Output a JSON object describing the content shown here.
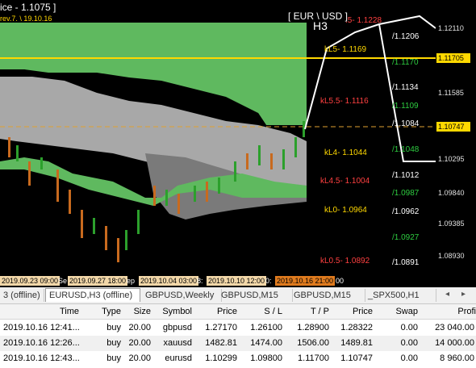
{
  "window": {
    "title": "ice - 1.1075 ]",
    "revision": "rev.7. \\ 19.10.16",
    "pair_label": "[ EUR \\ USD ]",
    "timeframe": "H3"
  },
  "price_axis": {
    "ticks": [
      "1.12110",
      "1.11585",
      "1.10295",
      "1.09840",
      "1.09385",
      "1.08930"
    ],
    "tags": [
      "1.11705",
      "1.10747"
    ]
  },
  "levels_left": [
    {
      "label": "kL5- 1.1169",
      "color": "#ffd800"
    },
    {
      "label": "kL5.5- 1.1116",
      "color": "#ff4040"
    },
    {
      "label": "kL4- 1.1044",
      "color": "#ffd800"
    },
    {
      "label": "kL4.5- 1.1004",
      "color": "#ff4040"
    },
    {
      "label": "kL0- 1.0964",
      "color": "#ffd800"
    },
    {
      "label": "kL0.5- 1.0892",
      "color": "#ff4040"
    },
    {
      "label": ".5- 1.1228",
      "color": "#ff4040"
    }
  ],
  "levels_right": [
    {
      "label": "/1.1206",
      "color": "#ffffff"
    },
    {
      "label": "/1.1170",
      "color": "#2ecc40"
    },
    {
      "label": "/1.1134",
      "color": "#ffffff"
    },
    {
      "label": "/1.1109",
      "color": "#2ecc40"
    },
    {
      "label": "/1.1084",
      "color": "#ffffff"
    },
    {
      "label": "/1.1048",
      "color": "#2ecc40"
    },
    {
      "label": "/1.1012",
      "color": "#ffffff"
    },
    {
      "label": "/1.0987",
      "color": "#2ecc40"
    },
    {
      "label": "/1.0962",
      "color": "#ffffff"
    },
    {
      "label": "/1.0927",
      "color": "#2ecc40"
    },
    {
      "label": "/1.0891",
      "color": "#ffffff"
    }
  ],
  "date_axis": {
    "labels": [
      "2019.09.23 09:00",
      "2019.09.27 18:00",
      "2019.10.04 03:00",
      "2019.10.10 12:00",
      "2019.10.16 21:00"
    ],
    "separators": [
      "Se",
      "ep",
      "8:",
      "0:",
      "00"
    ]
  },
  "tabs": {
    "items": [
      "3 (offline)",
      "EURUSD,H3 (offline)",
      "GBPUSD,Weekly",
      "GBPUSD,M15",
      "GBPUSD,M15",
      "_SPX500,H1"
    ],
    "active_index": 1,
    "nav_prev": "◂",
    "nav_next": "▸"
  },
  "trade_table": {
    "columns": [
      "Time",
      "Type",
      "Size",
      "Symbol",
      "Price",
      "S / L",
      "T / P",
      "Price",
      "Swap",
      "Profi"
    ],
    "rows": [
      [
        "2019.10.16 12:41...",
        "buy",
        "20.00",
        "gbpusd",
        "1.27170",
        "1.26100",
        "1.28900",
        "1.28322",
        "0.00",
        "23 040.00"
      ],
      [
        "2019.10.16 12:26...",
        "buy",
        "20.00",
        "xauusd",
        "1482.81",
        "1474.00",
        "1506.00",
        "1489.81",
        "0.00",
        "14 000.00"
      ],
      [
        "2019.10.16 12:43...",
        "buy",
        "20.00",
        "eurusd",
        "1.10299",
        "1.09800",
        "1.11700",
        "1.10747",
        "0.00",
        "8 960.00"
      ]
    ]
  },
  "colors": {
    "cloud_green": "#5fb95f",
    "cloud_gray": "#a8a8a8",
    "cloud_dark_gray": "#7a7a7a",
    "line_yellow": "#ffd800",
    "candle_up": "#2ca02c",
    "candle_down": "#c86a1e"
  }
}
